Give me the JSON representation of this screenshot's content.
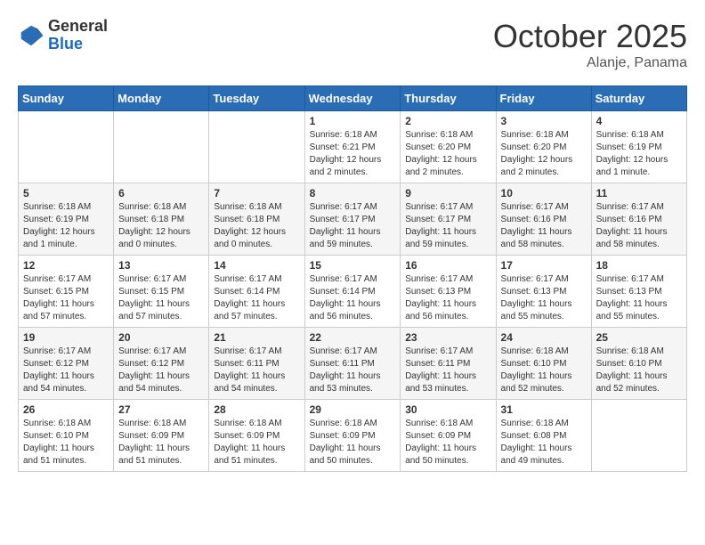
{
  "logo": {
    "general": "General",
    "blue": "Blue"
  },
  "title": "October 2025",
  "subtitle": "Alanje, Panama",
  "days_of_week": [
    "Sunday",
    "Monday",
    "Tuesday",
    "Wednesday",
    "Thursday",
    "Friday",
    "Saturday"
  ],
  "weeks": [
    [
      {
        "day": "",
        "info": ""
      },
      {
        "day": "",
        "info": ""
      },
      {
        "day": "",
        "info": ""
      },
      {
        "day": "1",
        "info": "Sunrise: 6:18 AM\nSunset: 6:21 PM\nDaylight: 12 hours\nand 2 minutes."
      },
      {
        "day": "2",
        "info": "Sunrise: 6:18 AM\nSunset: 6:20 PM\nDaylight: 12 hours\nand 2 minutes."
      },
      {
        "day": "3",
        "info": "Sunrise: 6:18 AM\nSunset: 6:20 PM\nDaylight: 12 hours\nand 2 minutes."
      },
      {
        "day": "4",
        "info": "Sunrise: 6:18 AM\nSunset: 6:19 PM\nDaylight: 12 hours\nand 1 minute."
      }
    ],
    [
      {
        "day": "5",
        "info": "Sunrise: 6:18 AM\nSunset: 6:19 PM\nDaylight: 12 hours\nand 1 minute."
      },
      {
        "day": "6",
        "info": "Sunrise: 6:18 AM\nSunset: 6:18 PM\nDaylight: 12 hours\nand 0 minutes."
      },
      {
        "day": "7",
        "info": "Sunrise: 6:18 AM\nSunset: 6:18 PM\nDaylight: 12 hours\nand 0 minutes."
      },
      {
        "day": "8",
        "info": "Sunrise: 6:17 AM\nSunset: 6:17 PM\nDaylight: 11 hours\nand 59 minutes."
      },
      {
        "day": "9",
        "info": "Sunrise: 6:17 AM\nSunset: 6:17 PM\nDaylight: 11 hours\nand 59 minutes."
      },
      {
        "day": "10",
        "info": "Sunrise: 6:17 AM\nSunset: 6:16 PM\nDaylight: 11 hours\nand 58 minutes."
      },
      {
        "day": "11",
        "info": "Sunrise: 6:17 AM\nSunset: 6:16 PM\nDaylight: 11 hours\nand 58 minutes."
      }
    ],
    [
      {
        "day": "12",
        "info": "Sunrise: 6:17 AM\nSunset: 6:15 PM\nDaylight: 11 hours\nand 57 minutes."
      },
      {
        "day": "13",
        "info": "Sunrise: 6:17 AM\nSunset: 6:15 PM\nDaylight: 11 hours\nand 57 minutes."
      },
      {
        "day": "14",
        "info": "Sunrise: 6:17 AM\nSunset: 6:14 PM\nDaylight: 11 hours\nand 57 minutes."
      },
      {
        "day": "15",
        "info": "Sunrise: 6:17 AM\nSunset: 6:14 PM\nDaylight: 11 hours\nand 56 minutes."
      },
      {
        "day": "16",
        "info": "Sunrise: 6:17 AM\nSunset: 6:13 PM\nDaylight: 11 hours\nand 56 minutes."
      },
      {
        "day": "17",
        "info": "Sunrise: 6:17 AM\nSunset: 6:13 PM\nDaylight: 11 hours\nand 55 minutes."
      },
      {
        "day": "18",
        "info": "Sunrise: 6:17 AM\nSunset: 6:13 PM\nDaylight: 11 hours\nand 55 minutes."
      }
    ],
    [
      {
        "day": "19",
        "info": "Sunrise: 6:17 AM\nSunset: 6:12 PM\nDaylight: 11 hours\nand 54 minutes."
      },
      {
        "day": "20",
        "info": "Sunrise: 6:17 AM\nSunset: 6:12 PM\nDaylight: 11 hours\nand 54 minutes."
      },
      {
        "day": "21",
        "info": "Sunrise: 6:17 AM\nSunset: 6:11 PM\nDaylight: 11 hours\nand 54 minutes."
      },
      {
        "day": "22",
        "info": "Sunrise: 6:17 AM\nSunset: 6:11 PM\nDaylight: 11 hours\nand 53 minutes."
      },
      {
        "day": "23",
        "info": "Sunrise: 6:17 AM\nSunset: 6:11 PM\nDaylight: 11 hours\nand 53 minutes."
      },
      {
        "day": "24",
        "info": "Sunrise: 6:18 AM\nSunset: 6:10 PM\nDaylight: 11 hours\nand 52 minutes."
      },
      {
        "day": "25",
        "info": "Sunrise: 6:18 AM\nSunset: 6:10 PM\nDaylight: 11 hours\nand 52 minutes."
      }
    ],
    [
      {
        "day": "26",
        "info": "Sunrise: 6:18 AM\nSunset: 6:10 PM\nDaylight: 11 hours\nand 51 minutes."
      },
      {
        "day": "27",
        "info": "Sunrise: 6:18 AM\nSunset: 6:09 PM\nDaylight: 11 hours\nand 51 minutes."
      },
      {
        "day": "28",
        "info": "Sunrise: 6:18 AM\nSunset: 6:09 PM\nDaylight: 11 hours\nand 51 minutes."
      },
      {
        "day": "29",
        "info": "Sunrise: 6:18 AM\nSunset: 6:09 PM\nDaylight: 11 hours\nand 50 minutes."
      },
      {
        "day": "30",
        "info": "Sunrise: 6:18 AM\nSunset: 6:09 PM\nDaylight: 11 hours\nand 50 minutes."
      },
      {
        "day": "31",
        "info": "Sunrise: 6:18 AM\nSunset: 6:08 PM\nDaylight: 11 hours\nand 49 minutes."
      },
      {
        "day": "",
        "info": ""
      }
    ]
  ]
}
